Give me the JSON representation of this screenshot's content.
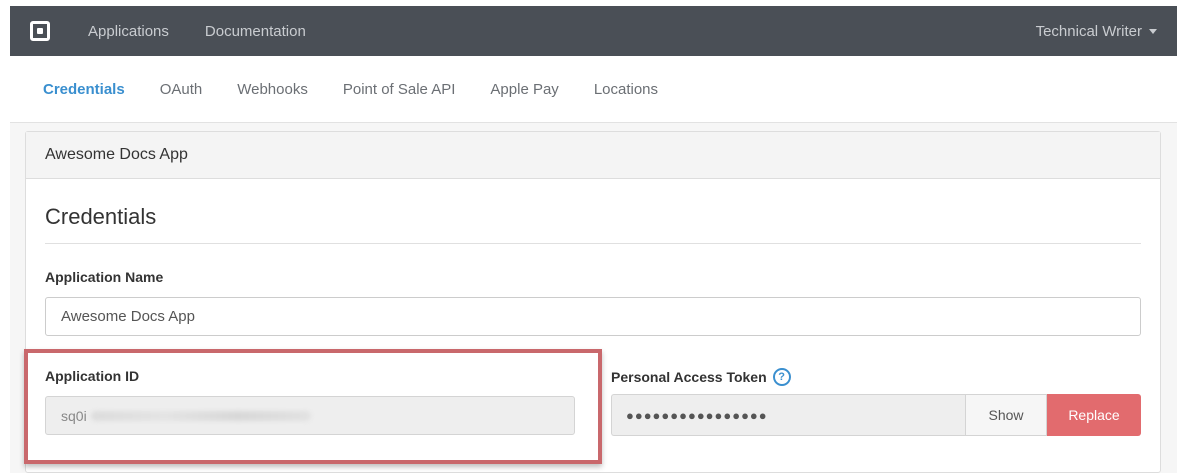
{
  "colors": {
    "navbar_bg": "#4a4f56",
    "accent": "#3a8fcf",
    "danger": "#e26b6e",
    "highlight": "#c9686c"
  },
  "navbar": {
    "logo_icon": "square-logo-icon",
    "links": [
      "Applications",
      "Documentation"
    ],
    "user": "Technical Writer"
  },
  "tabs": {
    "items": [
      "Credentials",
      "OAuth",
      "Webhooks",
      "Point of Sale API",
      "Apple Pay",
      "Locations"
    ],
    "active": "Credentials"
  },
  "panel": {
    "header": "Awesome Docs App",
    "section_title": "Credentials",
    "application_name": {
      "label": "Application Name",
      "value": "Awesome Docs App"
    },
    "application_id": {
      "label": "Application ID",
      "value_visible": "sq0i"
    },
    "personal_access_token": {
      "label": "Personal Access Token",
      "help_icon": "question-circle-icon",
      "masked_value": "●●●●●●●●●●●●●●●●",
      "show_label": "Show",
      "replace_label": "Replace"
    }
  }
}
